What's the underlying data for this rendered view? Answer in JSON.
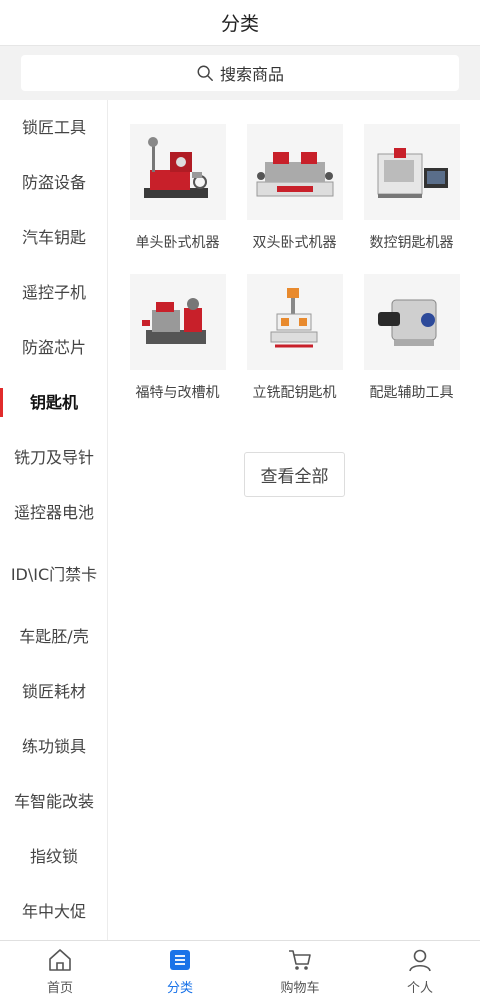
{
  "header": {
    "title": "分类"
  },
  "search": {
    "placeholder": "搜索商品",
    "icon": "search-icon"
  },
  "sidebar": {
    "items": [
      {
        "label": "锁匠工具",
        "active": false
      },
      {
        "label": "防盗设备",
        "active": false
      },
      {
        "label": "汽车钥匙",
        "active": false
      },
      {
        "label": "遥控子机",
        "active": false
      },
      {
        "label": "防盗芯片",
        "active": false
      },
      {
        "label": "钥匙机",
        "active": true
      },
      {
        "label": "铣刀及导针",
        "active": false
      },
      {
        "label": "遥控器电池",
        "active": false
      },
      {
        "label": "ID\\IC门禁卡",
        "active": false
      },
      {
        "label": "车匙胚/壳",
        "active": false
      },
      {
        "label": "锁匠耗材",
        "active": false
      },
      {
        "label": "练功锁具",
        "active": false
      },
      {
        "label": "车智能改装",
        "active": false
      },
      {
        "label": "指纹锁",
        "active": false
      },
      {
        "label": "年中大促",
        "active": false
      }
    ],
    "accent_color": "#e12b2b"
  },
  "products": [
    {
      "name": "单头卧式机器",
      "image": "key-machine-single-image"
    },
    {
      "name": "双头卧式机器",
      "image": "key-machine-double-image"
    },
    {
      "name": "数控钥匙机器",
      "image": "cnc-key-machine-image"
    },
    {
      "name": "福特与改槽机",
      "image": "ford-groove-machine-image"
    },
    {
      "name": "立铣配钥匙机",
      "image": "vertical-milling-machine-image"
    },
    {
      "name": "配匙辅助工具",
      "image": "key-auxiliary-tool-image"
    }
  ],
  "view_all": {
    "label": "查看全部"
  },
  "tabbar": {
    "tabs": [
      {
        "label": "首页",
        "icon": "home-icon",
        "active": false
      },
      {
        "label": "分类",
        "icon": "category-icon",
        "active": true
      },
      {
        "label": "购物车",
        "icon": "cart-icon",
        "active": false
      },
      {
        "label": "个人",
        "icon": "user-icon",
        "active": false
      }
    ],
    "active_color": "#1a73e8"
  }
}
